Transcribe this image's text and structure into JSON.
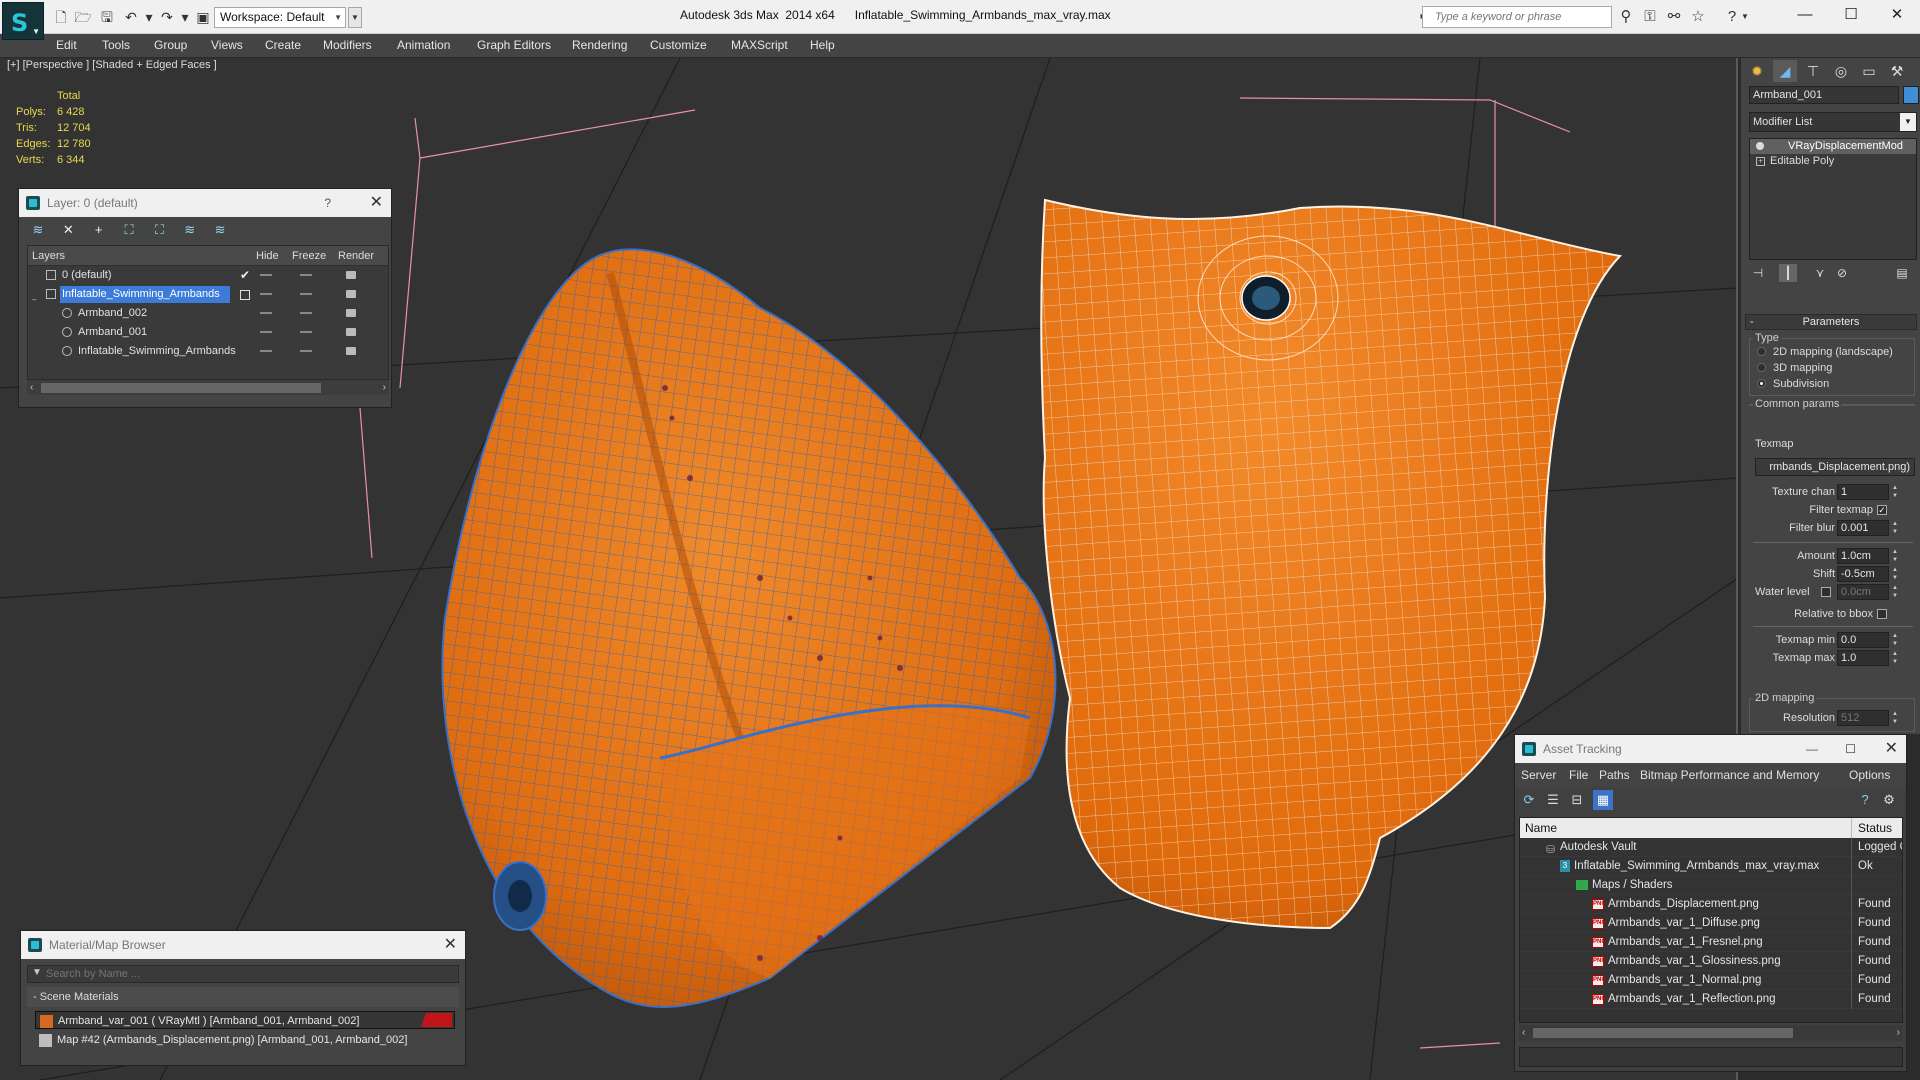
{
  "window": {
    "app_title": "Autodesk 3ds Max  2014 x64",
    "file_title": "Inflatable_Swimming_Armbands_max_vray.max",
    "workspace": "Workspace: Default",
    "search_placeholder": "Type a keyword or phrase"
  },
  "menu": [
    "Edit",
    "Tools",
    "Group",
    "Views",
    "Create",
    "Modifiers",
    "Animation",
    "Graph Editors",
    "Rendering",
    "Customize",
    "MAXScript",
    "Help"
  ],
  "viewport": {
    "label": "[+] [Perspective ] [Shaded + Edged Faces ]",
    "stats": {
      "header": "Total",
      "rows": [
        {
          "label": "Polys:",
          "value": "6 428"
        },
        {
          "label": "Tris:",
          "value": "12 704"
        },
        {
          "label": "Edges:",
          "value": "12 780"
        },
        {
          "label": "Verts:",
          "value": "6 344"
        }
      ]
    }
  },
  "layer_panel": {
    "title": "Layer: 0 (default)",
    "help": "?",
    "columns": [
      "Layers",
      "Hide",
      "Freeze",
      "Render"
    ],
    "rows": [
      {
        "name": "0 (default)"
      },
      {
        "name": "Inflatable_Swimming_Armbands"
      },
      {
        "name": "Armband_002"
      },
      {
        "name": "Armband_001"
      },
      {
        "name": "Inflatable_Swimming_Armbands"
      }
    ]
  },
  "material_panel": {
    "title": "Material/Map Browser",
    "search_placeholder": "Search by Name ...",
    "section": "- Scene Materials",
    "items": [
      {
        "label": "Armband_var_001  ( VRayMtl )  [Armband_001, Armband_002]",
        "swatch": "#d4691f"
      },
      {
        "label": "Map #42 (Armbands_Displacement.png)  [Armband_001, Armband_002]",
        "swatch": "#bdbdbd"
      }
    ]
  },
  "asset_panel": {
    "title": "Asset Tracking",
    "menu": [
      "Server",
      "File",
      "Paths",
      "Bitmap Performance and Memory",
      "Options"
    ],
    "columns": [
      "Name",
      "Status"
    ],
    "rows": [
      {
        "name": "Autodesk Vault",
        "status": "Logged Out",
        "indent": 0,
        "icon": "vault"
      },
      {
        "name": "Inflatable_Swimming_Armbands_max_vray.max",
        "status": "Ok",
        "indent": 1,
        "icon": "max"
      },
      {
        "name": "Maps / Shaders",
        "status": "",
        "indent": 2,
        "icon": "maps"
      },
      {
        "name": "Armbands_Displacement.png",
        "status": "Found",
        "indent": 3,
        "icon": "png"
      },
      {
        "name": "Armbands_var_1_Diffuse.png",
        "status": "Found",
        "indent": 3,
        "icon": "png"
      },
      {
        "name": "Armbands_var_1_Fresnel.png",
        "status": "Found",
        "indent": 3,
        "icon": "png"
      },
      {
        "name": "Armbands_var_1_Glossiness.png",
        "status": "Found",
        "indent": 3,
        "icon": "png"
      },
      {
        "name": "Armbands_var_1_Normal.png",
        "status": "Found",
        "indent": 3,
        "icon": "png"
      },
      {
        "name": "Armbands_var_1_Reflection.png",
        "status": "Found",
        "indent": 3,
        "icon": "png"
      }
    ]
  },
  "command_panel": {
    "object_name": "Armband_001",
    "object_color": "#3f8fd6",
    "modifier_list": "Modifier List",
    "stack": [
      "VRayDisplacementMod",
      "Editable Poly"
    ],
    "parameters_title": "Parameters",
    "type_group": "Type",
    "type_options": [
      "2D mapping (landscape)",
      "3D mapping",
      "Subdivision"
    ],
    "selected_type": "Subdivision",
    "common_group": "Common params",
    "texmap_label": "Texmap",
    "texmap_value": "rmbands_Displacement.png)",
    "texture_chan_label": "Texture chan",
    "texture_chan": "1",
    "filter_texmap_label": "Filter texmap",
    "filter_blur_label": "Filter blur",
    "filter_blur": "0.001",
    "amount_label": "Amount",
    "amount": "1.0cm",
    "shift_label": "Shift",
    "shift": "-0.5cm",
    "water_label": "Water level",
    "water": "0.0cm",
    "relative_label": "Relative to bbox",
    "texmap_min_label": "Texmap min",
    "texmap_min": "0.0",
    "texmap_max_label": "Texmap max",
    "texmap_max": "1.0",
    "mapping2d_group": "2D mapping",
    "resolution_label": "Resolution",
    "resolution": "512"
  }
}
